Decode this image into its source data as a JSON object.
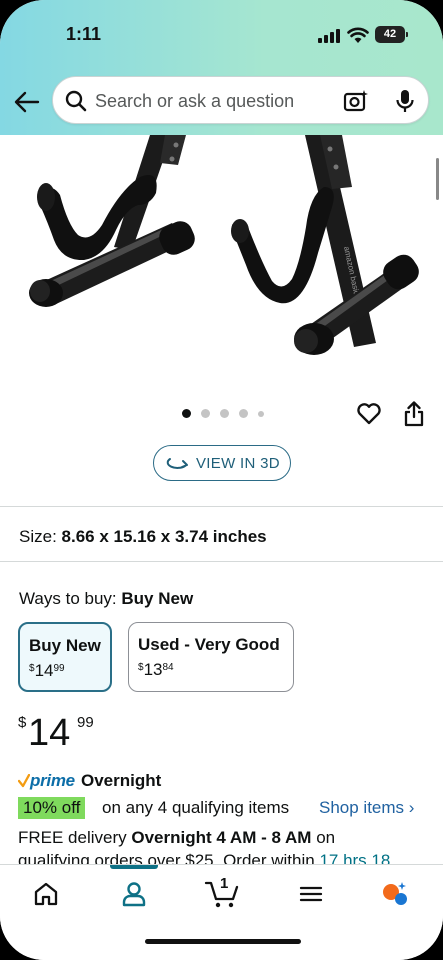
{
  "status_bar": {
    "time": "1:11",
    "battery": "42"
  },
  "search": {
    "placeholder": "Search or ask a question"
  },
  "gallery": {
    "dot_count": 5,
    "active_dot": 0
  },
  "view3d": {
    "label": "VIEW IN 3D"
  },
  "size": {
    "label": "Size:",
    "value": "8.66 x 15.16 x 3.74 inches"
  },
  "ways_to_buy": {
    "label": "Ways to buy:",
    "selected": "Buy New",
    "options": [
      {
        "title": "Buy New",
        "currency": "$",
        "whole": "14",
        "fraction": "99"
      },
      {
        "title": "Used - Very Good",
        "currency": "$",
        "whole": "13",
        "fraction": "84"
      }
    ]
  },
  "price": {
    "currency": "$",
    "whole": "14",
    "fraction": "99"
  },
  "prime": {
    "logo_text": "prime",
    "speed": "Overnight"
  },
  "promo": {
    "badge": "10% off",
    "text": "on any 4 qualifying items",
    "link": "Shop items ›"
  },
  "delivery": {
    "prefix": "FREE delivery ",
    "window": "Overnight 4 AM - 8 AM",
    "suffix": " on",
    "line2_prefix": "qualifying orders over $25. Order within ",
    "time_left": "17 hrs 18"
  },
  "tabbar": {
    "cart_count": "1",
    "active_tab": "account"
  },
  "colors": {
    "accent": "#0e7186",
    "prime_blue": "#0d6ea8",
    "link": "#2162a1",
    "promo_green": "#7fda5d",
    "header_start": "#84d8e3",
    "header_end": "#a8e7cc"
  }
}
